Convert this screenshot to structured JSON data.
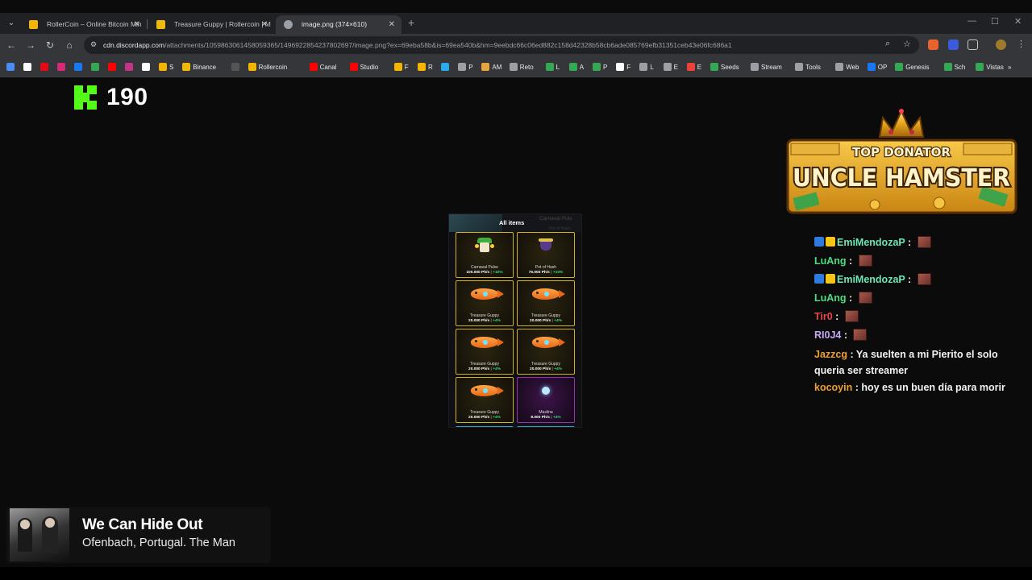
{
  "browser": {
    "tabs": [
      {
        "label": "RollerCoin – Online Bitcoin Min",
        "active": false
      },
      {
        "label": "Treasure Guppy | Rollercoin | M",
        "active": false
      },
      {
        "label": "image.png (374×610)",
        "active": true
      }
    ],
    "url_host": "cdn.discordapp.com",
    "url_path": "/attachments/1059863061458059365/1496922854237802697/image.png?ex=69eba58b&is=69ea540b&hm=9eebdc66c06ed882c158d42328b58cb6ade085769efb31351ceb43e06fc686a1",
    "bookmarks": [
      {
        "label": "",
        "color": "#4c8bf5"
      },
      {
        "label": "",
        "color": "#ffffff"
      },
      {
        "label": "",
        "color": "#e50914"
      },
      {
        "label": "",
        "color": "#d62976"
      },
      {
        "label": "",
        "color": "#1877f2"
      },
      {
        "label": "",
        "color": "#34a853"
      },
      {
        "label": "",
        "color": "#ff0000"
      },
      {
        "label": "",
        "color": "#c13584"
      },
      {
        "label": "",
        "color": "#ffffff"
      },
      {
        "label": "S",
        "color": "#f4b400"
      },
      {
        "label": "Binance",
        "color": "#f0b90b"
      },
      {
        "label": "",
        "color": "#555555"
      },
      {
        "label": "Rollercoin",
        "color": "#f4b400"
      },
      {
        "label": "Canal",
        "color": "#ff0000"
      },
      {
        "label": "Studio",
        "color": "#ff0000"
      },
      {
        "label": "F",
        "color": "#f4b400"
      },
      {
        "label": "R",
        "color": "#f4b400"
      },
      {
        "label": "",
        "color": "#2aabee"
      },
      {
        "label": "P",
        "color": "#9aa0a6"
      },
      {
        "label": "AM",
        "color": "#e8a33d"
      },
      {
        "label": "Reto",
        "color": "#9aa0a6"
      },
      {
        "label": "L",
        "color": "#34a853"
      },
      {
        "label": "A",
        "color": "#34a853"
      },
      {
        "label": "P",
        "color": "#34a853"
      },
      {
        "label": "F",
        "color": "#ffffff"
      },
      {
        "label": "L",
        "color": "#9aa0a6"
      },
      {
        "label": "E",
        "color": "#9aa0a6"
      },
      {
        "label": "E",
        "color": "#ea4335"
      },
      {
        "label": "Seeds",
        "color": "#34a853"
      },
      {
        "label": "Stream",
        "color": "#9aa0a6"
      },
      {
        "label": "Tools",
        "color": "#9aa0a6"
      },
      {
        "label": "Web",
        "color": "#9aa0a6"
      },
      {
        "label": "OP",
        "color": "#1877f2"
      },
      {
        "label": "Genesis",
        "color": "#34a853"
      },
      {
        "label": "Sch",
        "color": "#34a853"
      },
      {
        "label": "Vistas",
        "color": "#34a853"
      }
    ],
    "more_bookmarks": "»"
  },
  "kick": {
    "count": "190",
    "brand_color": "#53fc18"
  },
  "inventory": {
    "title": "All items",
    "ghost_text": "Carnaval Puls",
    "ghost_text2": "Pot of Hash",
    "items": [
      {
        "name": "Carnaval Pulse",
        "power": "100.000 Ph/s",
        "bonus": "+10%",
        "rarity": "gold",
        "icon": "carnaval-pulse-icon"
      },
      {
        "name": "Pot of Hash",
        "power": "75.000 Ph/s",
        "bonus": "+10%",
        "rarity": "gold",
        "icon": "pot-of-hash-icon"
      },
      {
        "name": "Treasure Guppy",
        "power": "20.000 Ph/s",
        "bonus": "+4%",
        "rarity": "gold",
        "icon": "treasure-guppy-icon"
      },
      {
        "name": "Treasure Guppy",
        "power": "20.000 Ph/s",
        "bonus": "+4%",
        "rarity": "gold",
        "icon": "treasure-guppy-icon"
      },
      {
        "name": "Treasure Guppy",
        "power": "20.000 Ph/s",
        "bonus": "+4%",
        "rarity": "gold",
        "icon": "treasure-guppy-icon"
      },
      {
        "name": "Treasure Guppy",
        "power": "20.000 Ph/s",
        "bonus": "+4%",
        "rarity": "gold",
        "icon": "treasure-guppy-icon"
      },
      {
        "name": "Treasure Guppy",
        "power": "20.000 Ph/s",
        "bonus": "+4%",
        "rarity": "gold",
        "icon": "treasure-guppy-icon"
      },
      {
        "name": "Maslina",
        "power": "8.000 Ph/s",
        "bonus": "+3%",
        "rarity": "purple",
        "icon": "maslina-icon"
      }
    ]
  },
  "donator": {
    "top_text": "TOP DONATOR",
    "name": "UNCLE HAMSTER"
  },
  "chat": [
    {
      "user": "EmiMendozaP",
      "color": "#6ee7b7",
      "badges": true,
      "message": "",
      "emote": true
    },
    {
      "user": "LuAng",
      "color": "#4ade80",
      "badges": false,
      "message": "",
      "emote": true
    },
    {
      "user": "EmiMendozaP",
      "color": "#6ee7b7",
      "badges": true,
      "message": "",
      "emote": true
    },
    {
      "user": "LuAng",
      "color": "#4ade80",
      "badges": false,
      "message": "",
      "emote": true
    },
    {
      "user": "Tir0",
      "color": "#ef4444",
      "badges": false,
      "message": "",
      "emote": true
    },
    {
      "user": "RI0J4",
      "color": "#c4a7f5",
      "badges": false,
      "message": "",
      "emote": true
    },
    {
      "user": "Jazzcg",
      "color": "#f0a030",
      "badges": false,
      "message": "Ya suelten a mi Pierito el solo queria ser streamer",
      "emote": false
    },
    {
      "user": "kocoyin",
      "color": "#f0a030",
      "badges": false,
      "message": "hoy es un buen día para morir",
      "emote": false
    }
  ],
  "now_playing": {
    "title": "We Can Hide Out",
    "artist": "Ofenbach, Portugal. The Man"
  }
}
